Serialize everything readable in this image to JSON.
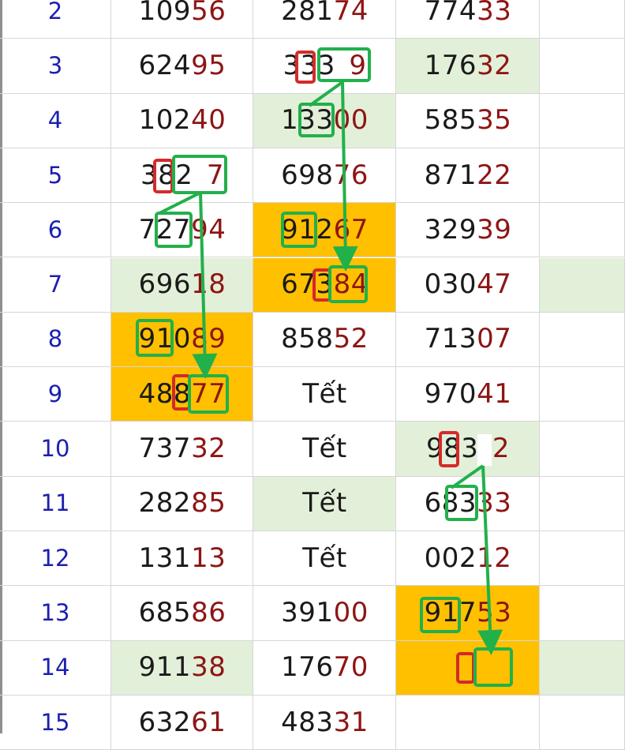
{
  "colors": {
    "highlight_orange": "#ffc000",
    "highlight_green": "#e2f0d9",
    "row_number": "#1b1fb0",
    "last_two_digits": "#8e1515",
    "marker_green": "#22b04b",
    "marker_red": "#d42a2a"
  },
  "table": {
    "rows": [
      {
        "n": "2",
        "cells": [
          {
            "hi": "109",
            "lo": "56",
            "bg": ""
          },
          {
            "hi": "281",
            "lo": "74",
            "bg": ""
          },
          {
            "hi": "774",
            "lo": "33",
            "bg": ""
          },
          {
            "bg": ""
          }
        ]
      },
      {
        "n": "3",
        "cells": [
          {
            "hi": "62495",
            "lo": "",
            "bg": "",
            "split": [
              3,
              2
            ]
          },
          {
            "hi": "333",
            "lo": "9",
            "bg": "",
            "gap": true
          },
          {
            "hi": "176",
            "lo": "32",
            "bg": "green"
          },
          {
            "bg": ""
          }
        ]
      },
      {
        "n": "4",
        "cells": [
          {
            "hi": "102",
            "lo": "40",
            "bg": ""
          },
          {
            "hi": "133",
            "lo": "00",
            "bg": "green"
          },
          {
            "hi": "585",
            "lo": "35",
            "bg": ""
          },
          {
            "bg": ""
          }
        ]
      },
      {
        "n": "5",
        "cells": [
          {
            "hi": "382",
            "lo": "7",
            "bg": "",
            "gap": true
          },
          {
            "hi": "698",
            "lo": "76",
            "bg": ""
          },
          {
            "hi": "871",
            "lo": "22",
            "bg": ""
          },
          {
            "bg": ""
          }
        ]
      },
      {
        "n": "6",
        "cells": [
          {
            "hi": "727",
            "lo": "94",
            "bg": ""
          },
          {
            "hi": "912",
            "lo": "67",
            "bg": "orange"
          },
          {
            "hi": "329",
            "lo": "39",
            "bg": ""
          },
          {
            "bg": ""
          }
        ]
      },
      {
        "n": "7",
        "cells": [
          {
            "hi": "696",
            "lo": "18",
            "bg": "green"
          },
          {
            "hi": "673",
            "lo": "84",
            "bg": "orange"
          },
          {
            "hi": "030",
            "lo": "47",
            "bg": ""
          },
          {
            "bg": "green"
          }
        ]
      },
      {
        "n": "8",
        "cells": [
          {
            "hi": "910",
            "lo": "89",
            "bg": "orange"
          },
          {
            "hi": "858",
            "lo": "52",
            "bg": ""
          },
          {
            "hi": "713",
            "lo": "07",
            "bg": ""
          },
          {
            "bg": ""
          }
        ]
      },
      {
        "n": "9",
        "cells": [
          {
            "hi": "488",
            "lo": "77",
            "bg": "orange"
          },
          {
            "tet": "Tết",
            "bg": ""
          },
          {
            "hi": "970",
            "lo": "41",
            "bg": ""
          },
          {
            "bg": ""
          }
        ]
      },
      {
        "n": "10",
        "cells": [
          {
            "hi": "737",
            "lo": "32",
            "bg": ""
          },
          {
            "tet": "Tết",
            "bg": ""
          },
          {
            "hi": "983",
            "lo": "2",
            "bg": "green",
            "gap": true
          },
          {
            "bg": ""
          }
        ]
      },
      {
        "n": "11",
        "cells": [
          {
            "hi": "282",
            "lo": "85",
            "bg": ""
          },
          {
            "tet": "Tết",
            "bg": "green"
          },
          {
            "hi": "683",
            "lo": "33",
            "bg": ""
          },
          {
            "bg": ""
          }
        ]
      },
      {
        "n": "12",
        "cells": [
          {
            "hi": "131",
            "lo": "13",
            "bg": ""
          },
          {
            "tet": "Tết",
            "bg": ""
          },
          {
            "hi": "002",
            "lo": "12",
            "bg": ""
          },
          {
            "bg": ""
          }
        ]
      },
      {
        "n": "13",
        "cells": [
          {
            "hi": "685",
            "lo": "86",
            "bg": ""
          },
          {
            "hi": "391",
            "lo": "00",
            "bg": ""
          },
          {
            "hi": "917",
            "lo": "53",
            "bg": "orange"
          },
          {
            "bg": ""
          }
        ]
      },
      {
        "n": "14",
        "cells": [
          {
            "hi": "911",
            "lo": "38",
            "bg": "green"
          },
          {
            "hi": "176",
            "lo": "70",
            "bg": ""
          },
          {
            "hi": "",
            "lo": "",
            "bg": "orange"
          },
          {
            "bg": "green"
          }
        ]
      },
      {
        "n": "15",
        "cells": [
          {
            "hi": "632",
            "lo": "61",
            "bg": ""
          },
          {
            "hi": "483",
            "lo": "31",
            "bg": ""
          },
          {
            "hi": "",
            "lo": "",
            "bg": ""
          },
          {
            "bg": ""
          }
        ]
      }
    ]
  }
}
